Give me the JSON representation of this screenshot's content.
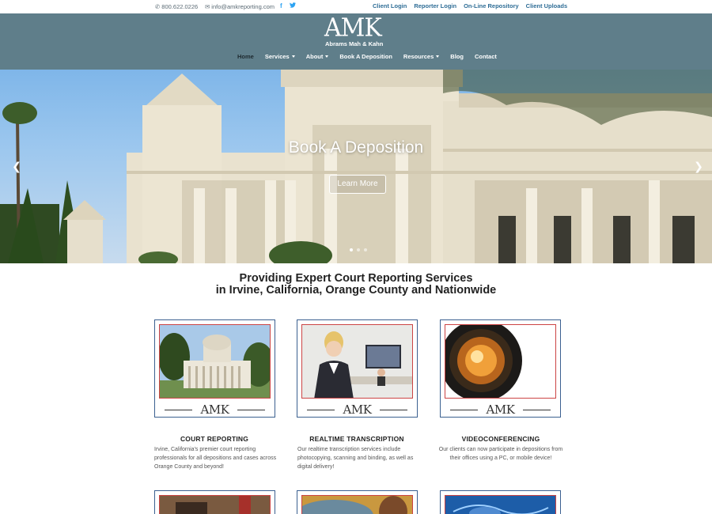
{
  "topbar": {
    "phone": "800.622.0226",
    "email": "info@amkreporting.com",
    "links": [
      "Client Login",
      "Reporter Login",
      "On-Line Repository",
      "Client Uploads"
    ]
  },
  "logo": {
    "mark": "AMK",
    "subtitle": "Abrams Mah & Kahn"
  },
  "nav": {
    "items": [
      {
        "label": "Home",
        "dropdown": false,
        "active": true
      },
      {
        "label": "Services",
        "dropdown": true
      },
      {
        "label": "About",
        "dropdown": true
      },
      {
        "label": "Book A Deposition",
        "dropdown": false
      },
      {
        "label": "Resources",
        "dropdown": true
      },
      {
        "label": "Blog",
        "dropdown": false
      },
      {
        "label": "Contact",
        "dropdown": false
      }
    ]
  },
  "hero": {
    "title": "Book A Deposition",
    "button": "Learn More",
    "prev_icon": "chevron-left-icon",
    "next_icon": "chevron-right-icon",
    "slides": 3,
    "active_slide": 1
  },
  "headline": {
    "line1": "Providing Expert Court Reporting Services",
    "line2": "in Irvine, California, Orange County and Nationwide"
  },
  "services": [
    {
      "badge": "AMK",
      "title": "COURT REPORTING",
      "text": "Irvine, California's premier court reporting professionals for all depositions and cases across Orange County and beyond!"
    },
    {
      "badge": "AMK",
      "title": "REALTIME TRANSCRIPTION",
      "text": "Our realtime transcription services include photocopying, scanning and binding, as well as digital delivery!"
    },
    {
      "badge": "AMK",
      "title": "VIDEOCONFERENCING",
      "text": "Our clients can now participate in depositions from their offices using a PC, or mobile device!"
    }
  ],
  "colors": {
    "header": "#5f7e8a",
    "link": "#2e6d96",
    "card_border": "#3b6090",
    "photo_border": "#cc4444"
  }
}
